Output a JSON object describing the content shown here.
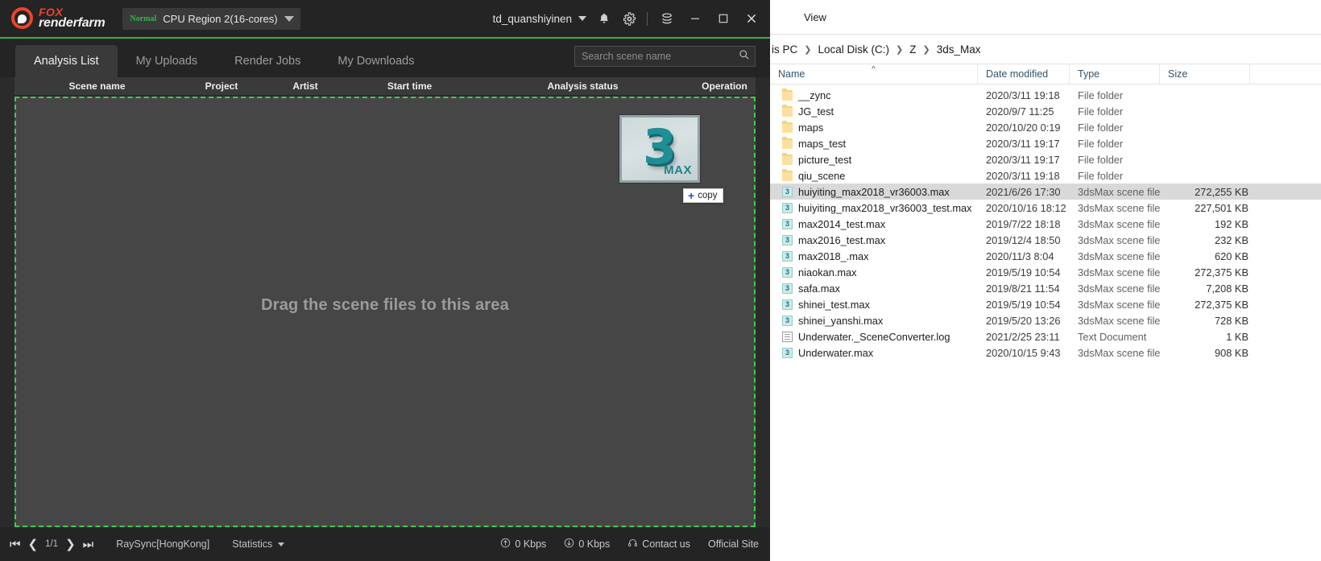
{
  "app": {
    "brand": {
      "fox": "FOX",
      "renderfarm": "renderfarm"
    },
    "region": {
      "badge": "Normal",
      "label": "CPU Region 2(16-cores)"
    },
    "user": {
      "name": "td_quanshiyinen"
    },
    "tabs": [
      {
        "label": "Analysis List",
        "active": true
      },
      {
        "label": "My Uploads",
        "active": false
      },
      {
        "label": "Render Jobs",
        "active": false
      },
      {
        "label": "My Downloads",
        "active": false
      }
    ],
    "search": {
      "value": "",
      "placeholder": "Search scene name"
    },
    "columns": [
      "Scene name",
      "Project",
      "Artist",
      "Start time",
      "Analysis status",
      "Operation"
    ],
    "dropzone": {
      "text": "Drag the scene files to this area",
      "drag_icon_label": "MAX",
      "drag_icon_digit": "3",
      "copy_badge": "copy",
      "copy_plus": "+"
    },
    "statusbar": {
      "page": "1/1",
      "raysync": "RaySync[HongKong]",
      "statistics": "Statistics",
      "upload_speed": "0 Kbps",
      "download_speed": "0 Kbps",
      "contact": "Contact us",
      "official": "Official Site"
    }
  },
  "explorer": {
    "ribbon_tab": "View",
    "breadcrumb": [
      "is PC",
      "Local Disk (C:)",
      "Z",
      "3ds_Max"
    ],
    "columns": [
      "Name",
      "Date modified",
      "Type",
      "Size"
    ],
    "rows": [
      {
        "name": "__zync",
        "date": "2020/3/11 19:18",
        "type": "File folder",
        "size": "",
        "icon": "folder-icon",
        "selected": false
      },
      {
        "name": "JG_test",
        "date": "2020/9/7 11:25",
        "type": "File folder",
        "size": "",
        "icon": "folder-icon",
        "selected": false
      },
      {
        "name": "maps",
        "date": "2020/10/20 0:19",
        "type": "File folder",
        "size": "",
        "icon": "folder-icon",
        "selected": false
      },
      {
        "name": "maps_test",
        "date": "2020/3/11 19:17",
        "type": "File folder",
        "size": "",
        "icon": "folder-icon",
        "selected": false
      },
      {
        "name": "picture_test",
        "date": "2020/3/11 19:17",
        "type": "File folder",
        "size": "",
        "icon": "folder-icon",
        "selected": false
      },
      {
        "name": "qiu_scene",
        "date": "2020/3/11 19:18",
        "type": "File folder",
        "size": "",
        "icon": "folder-icon",
        "selected": false
      },
      {
        "name": "huiyiting_max2018_vr36003.max",
        "date": "2021/6/26 17:30",
        "type": "3dsMax scene file",
        "size": "272,255 KB",
        "icon": "max-file-icon",
        "selected": true
      },
      {
        "name": "huiyiting_max2018_vr36003_test.max",
        "date": "2020/10/16 18:12",
        "type": "3dsMax scene file",
        "size": "227,501 KB",
        "icon": "max-file-icon",
        "selected": false
      },
      {
        "name": "max2014_test.max",
        "date": "2019/7/22 18:18",
        "type": "3dsMax scene file",
        "size": "192 KB",
        "icon": "max-file-icon",
        "selected": false
      },
      {
        "name": "max2016_test.max",
        "date": "2019/12/4 18:50",
        "type": "3dsMax scene file",
        "size": "232 KB",
        "icon": "max-file-icon",
        "selected": false
      },
      {
        "name": "max2018_.max",
        "date": "2020/11/3 8:04",
        "type": "3dsMax scene file",
        "size": "620 KB",
        "icon": "max-file-icon",
        "selected": false
      },
      {
        "name": "niaokan.max",
        "date": "2019/5/19 10:54",
        "type": "3dsMax scene file",
        "size": "272,375 KB",
        "icon": "max-file-icon",
        "selected": false
      },
      {
        "name": "safa.max",
        "date": "2019/8/21 11:54",
        "type": "3dsMax scene file",
        "size": "7,208 KB",
        "icon": "max-file-icon",
        "selected": false
      },
      {
        "name": "shinei_test.max",
        "date": "2019/5/19 10:54",
        "type": "3dsMax scene file",
        "size": "272,375 KB",
        "icon": "max-file-icon",
        "selected": false
      },
      {
        "name": "shinei_yanshi.max",
        "date": "2019/5/20 13:26",
        "type": "3dsMax scene file",
        "size": "728 KB",
        "icon": "max-file-icon",
        "selected": false
      },
      {
        "name": "Underwater._SceneConverter.log",
        "date": "2021/2/25 23:11",
        "type": "Text Document",
        "size": "1 KB",
        "icon": "text-file-icon",
        "selected": false
      },
      {
        "name": "Underwater.max",
        "date": "2020/10/15 9:43",
        "type": "3dsMax scene file",
        "size": "908 KB",
        "icon": "max-file-icon",
        "selected": false
      }
    ]
  },
  "colors": {
    "brand_red": "#e8452c",
    "accent_green": "#35b44a",
    "dashed_green": "#3fcc4f",
    "app_bg": "#2b2b2b",
    "panel_bg": "#464646"
  }
}
